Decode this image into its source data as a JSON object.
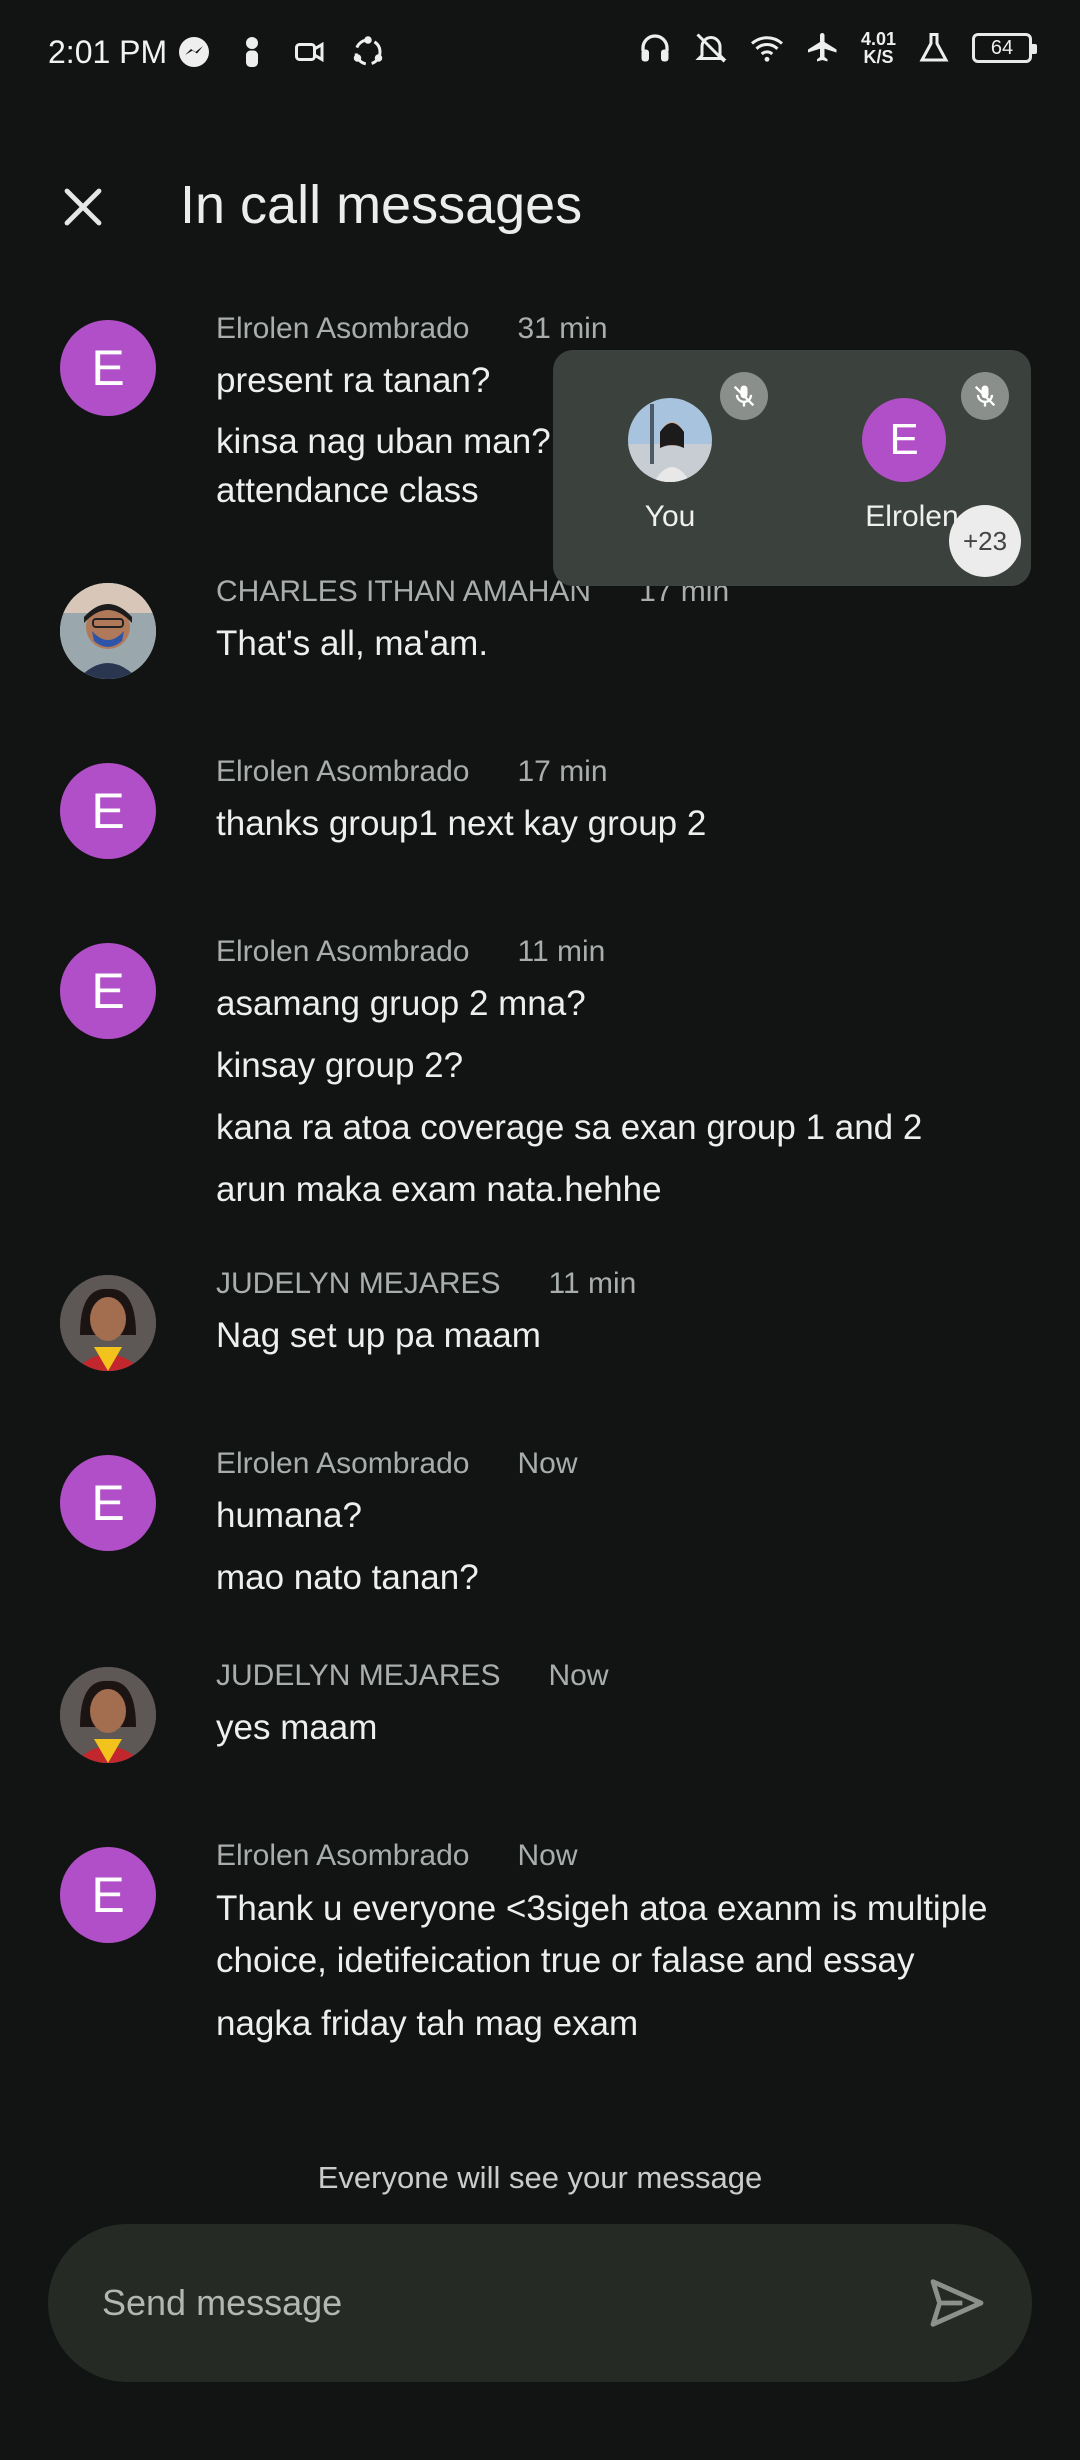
{
  "status": {
    "time": "2:01 PM",
    "speed_value": "4.01",
    "speed_unit": "K/S",
    "battery": "64"
  },
  "header": {
    "title": "In call messages"
  },
  "participants": {
    "tiles": [
      {
        "name": "You"
      },
      {
        "name": "Elrolen",
        "initial": "E"
      }
    ],
    "more_count": "+23"
  },
  "messages": [
    {
      "sender": "Elrolen Asombrado",
      "time": "31 min",
      "initial": "E",
      "lines": [
        "present ra tanan?",
        "kinsa nag uban man?",
        "attendance class"
      ]
    },
    {
      "sender": "CHARLES ITHAN AMAHAN",
      "time": "17 min",
      "lines": [
        "That's all, ma'am."
      ]
    },
    {
      "sender": "Elrolen Asombrado",
      "time": "17 min",
      "initial": "E",
      "lines": [
        "thanks group1 next kay group 2"
      ]
    },
    {
      "sender": "Elrolen Asombrado",
      "time": "11 min",
      "initial": "E",
      "lines": [
        "asamang gruop 2 mna?",
        "kinsay group 2?",
        "kana ra atoa coverage sa exan group 1 and 2",
        "arun maka exam nata.hehhe"
      ]
    },
    {
      "sender": "JUDELYN MEJARES",
      "time": "11 min",
      "lines": [
        "Nag set up pa maam"
      ]
    },
    {
      "sender": "Elrolen Asombrado",
      "time": "Now",
      "initial": "E",
      "lines": [
        "humana?",
        "mao nato tanan?"
      ]
    },
    {
      "sender": "JUDELYN MEJARES",
      "time": "Now",
      "lines": [
        "yes maam"
      ]
    },
    {
      "sender": "Elrolen Asombrado",
      "time": "Now",
      "initial": "E",
      "lines": [
        "Thank u everyone  <3sigeh atoa exanm is multiple choice, idetifeication true or falase and essay",
        "nagka friday tah mag exam"
      ]
    }
  ],
  "footer": {
    "notice": "Everyone will see your message",
    "input_placeholder": "Send message"
  },
  "colors": {
    "avatar_purple": "#b04fc7",
    "background": "#111412",
    "overlay": "#3b413c"
  }
}
